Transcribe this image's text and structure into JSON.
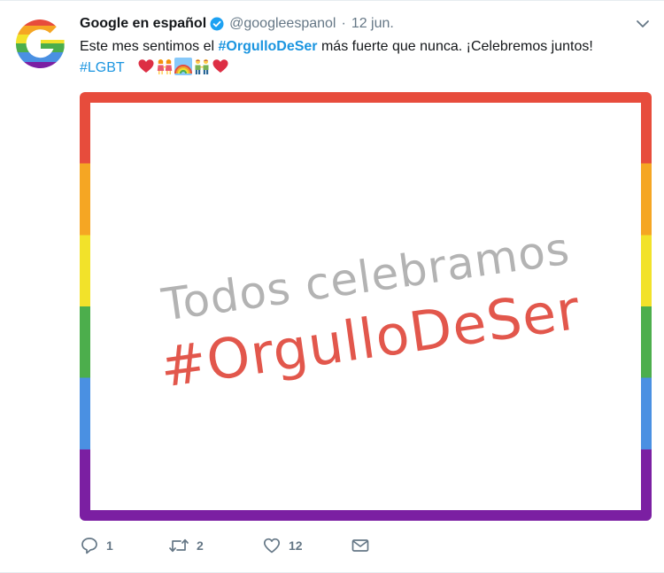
{
  "tweet": {
    "author": {
      "name": "Google en español",
      "handle": "@googleespanol",
      "verified": true,
      "avatar_icon": "google-pride-g-icon"
    },
    "separator": "·",
    "timestamp": "12 jun.",
    "text": {
      "part1": "Este mes sentimos el ",
      "hashtag1": "#OrgulloDeSer",
      "part2": " más fuerte que nunca. ¡Celebremos juntos! ",
      "hashtag2": "#LGBT",
      "emojis": [
        "red-heart",
        "two-women-holding-hands",
        "rainbow",
        "two-men-holding-hands",
        "red-heart"
      ]
    },
    "media": {
      "line1": "Todos celebramos",
      "line2": "#OrgulloDeSer",
      "border_colors": [
        "#e74c3c",
        "#f5a623",
        "#f2e22a",
        "#4cae4c",
        "#4a90e2",
        "#7b1fa2"
      ]
    },
    "actions": {
      "reply_count": "1",
      "retweet_count": "2",
      "like_count": "12"
    }
  },
  "colors": {
    "link": "#1b95e0",
    "secondary_text": "#657786",
    "verified_badge": "#1da1f2"
  }
}
